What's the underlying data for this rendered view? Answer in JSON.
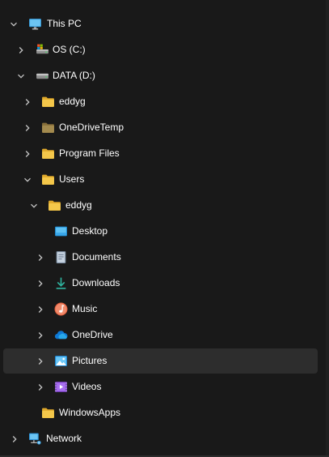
{
  "nav_tree": {
    "items": [
      {
        "label": "This PC",
        "icon": "monitor-icon",
        "expanded": true,
        "level": 0
      },
      {
        "label": "OS (C:)",
        "icon": "system-drive-icon",
        "expanded": false,
        "level": 1
      },
      {
        "label": "DATA (D:)",
        "icon": "drive-icon",
        "expanded": true,
        "level": 1
      },
      {
        "label": "eddyg",
        "icon": "folder-icon",
        "expanded": false,
        "level": 2
      },
      {
        "label": "OneDriveTemp",
        "icon": "hidden-folder-icon",
        "expanded": false,
        "level": 2
      },
      {
        "label": "Program Files",
        "icon": "folder-icon",
        "expanded": false,
        "level": 2
      },
      {
        "label": "Users",
        "icon": "folder-icon",
        "expanded": true,
        "level": 2
      },
      {
        "label": "eddyg",
        "icon": "folder-icon",
        "expanded": true,
        "level": 3
      },
      {
        "label": "Desktop",
        "icon": "desktop-icon",
        "expanded": null,
        "level": 4
      },
      {
        "label": "Documents",
        "icon": "documents-icon",
        "expanded": false,
        "level": 4
      },
      {
        "label": "Downloads",
        "icon": "download-icon",
        "expanded": false,
        "level": 4
      },
      {
        "label": "Music",
        "icon": "music-icon",
        "expanded": false,
        "level": 4
      },
      {
        "label": "OneDrive",
        "icon": "cloud-icon",
        "expanded": false,
        "level": 4
      },
      {
        "label": "Pictures",
        "icon": "pictures-icon",
        "expanded": false,
        "level": 4,
        "selected": true
      },
      {
        "label": "Videos",
        "icon": "videos-icon",
        "expanded": false,
        "level": 4
      },
      {
        "label": "WindowsApps",
        "icon": "folder-icon",
        "expanded": null,
        "level": 2
      },
      {
        "label": "Network",
        "icon": "network-icon",
        "expanded": false,
        "level": 0
      }
    ]
  },
  "colors": {
    "background": "#191919",
    "selected_row": "#2d2d2d",
    "text": "#ffffff",
    "chevron": "#c5c5c5",
    "folder": "#f4c74a",
    "hidden_folder": "#a38a4e"
  }
}
